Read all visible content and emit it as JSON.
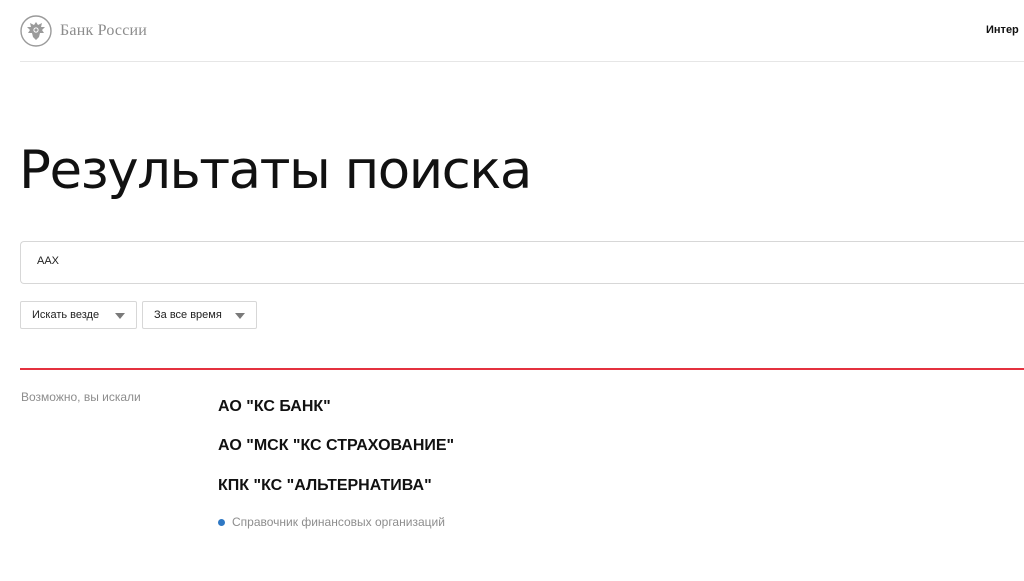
{
  "header": {
    "logo_text": "Банк России",
    "logo_icon": "eagle-emblem-icon",
    "nav_link": "Интер"
  },
  "page": {
    "title": "Результаты поиска"
  },
  "search": {
    "value": "ААХ",
    "icon": "search-icon"
  },
  "filters": {
    "scope": {
      "selected": "Искать везде",
      "icon": "chevron-down-icon"
    },
    "period": {
      "selected": "За все время",
      "icon": "chevron-down-icon"
    }
  },
  "colors": {
    "accent_divider": "#e4313f",
    "source_dot": "#2f78c4",
    "muted_text": "#8d8d8d"
  },
  "suggestions": {
    "label": "Возможно, вы искали",
    "items": [
      "АО \"КС БАНК\"",
      "АО \"МСК \"КС СТРАХОВАНИЕ\"",
      "КПК \"КС \"АЛЬТЕРНАТИВА\""
    ],
    "source": "Справочник финансовых организаций"
  }
}
